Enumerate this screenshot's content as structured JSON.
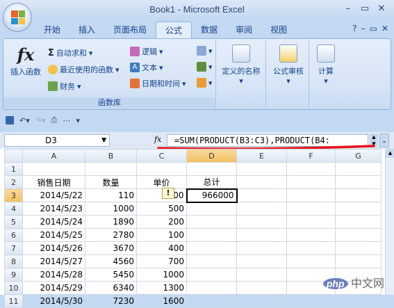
{
  "window": {
    "title": "Book1 - Microsoft Excel"
  },
  "tabs": [
    "开始",
    "插入",
    "页面布局",
    "公式",
    "数据",
    "审阅",
    "视图"
  ],
  "active_tab": "公式",
  "ribbon": {
    "insert_function": "插入函数",
    "autosum": "自动求和",
    "recent": "最近使用的函数",
    "financial": "财务",
    "logical": "逻辑",
    "text": "文本",
    "datetime": "日期和时间",
    "group_label": "函数库",
    "defined_names": "定义的名称",
    "formula_audit": "公式审核",
    "calculation": "计算"
  },
  "formula_bar": {
    "name_box": "D3",
    "fx_label": "fx",
    "formula": "=SUM(PRODUCT(B3:C3),PRODUCT(B4:"
  },
  "columns": [
    "A",
    "B",
    "C",
    "D",
    "E",
    "F",
    "G"
  ],
  "rows": [
    {
      "n": "1",
      "a": "",
      "b": "",
      "c": "",
      "d": ""
    },
    {
      "n": "2",
      "a": "销售日期",
      "b": "数量",
      "c": "单价",
      "d": "总计"
    },
    {
      "n": "3",
      "a": "2014/5/22",
      "b": "110",
      "c": "00",
      "d": "966000"
    },
    {
      "n": "4",
      "a": "2014/5/23",
      "b": "1000",
      "c": "500",
      "d": ""
    },
    {
      "n": "5",
      "a": "2014/5/24",
      "b": "1890",
      "c": "200",
      "d": ""
    },
    {
      "n": "6",
      "a": "2014/5/25",
      "b": "2780",
      "c": "100",
      "d": ""
    },
    {
      "n": "7",
      "a": "2014/5/26",
      "b": "3670",
      "c": "400",
      "d": ""
    },
    {
      "n": "8",
      "a": "2014/5/27",
      "b": "4560",
      "c": "700",
      "d": ""
    },
    {
      "n": "9",
      "a": "2014/5/28",
      "b": "5450",
      "c": "1000",
      "d": ""
    },
    {
      "n": "10",
      "a": "2014/5/29",
      "b": "6340",
      "c": "1300",
      "d": ""
    },
    {
      "n": "11",
      "a": "2014/5/30",
      "b": "7230",
      "c": "1600",
      "d": ""
    }
  ],
  "watermark": {
    "badge": "php",
    "text": "中文网"
  }
}
